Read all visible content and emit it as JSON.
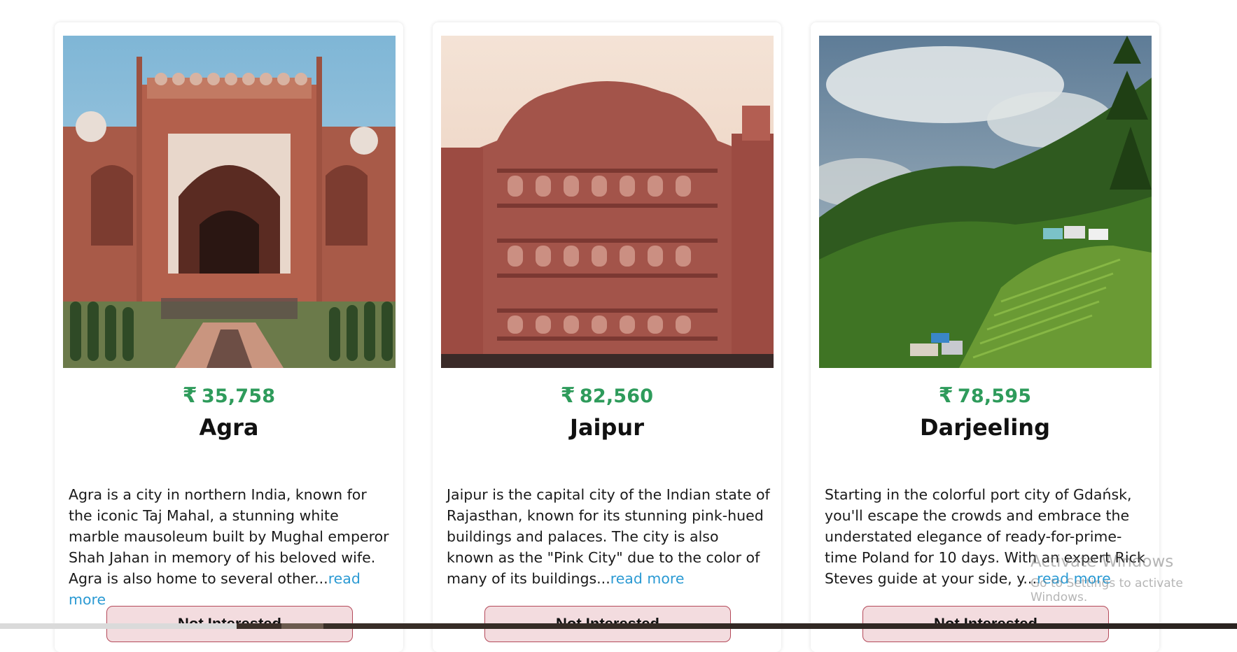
{
  "cards": [
    {
      "price": "35,758",
      "currency_symbol": "₹",
      "title": "Agra",
      "description": "Agra is a city in northern India, known for the iconic Taj Mahal, a stunning white marble mausoleum built by Mughal emperor Shah Jahan in memory of his beloved wife. Agra is also home to several other...",
      "read_more": "read more",
      "button_label": "Not Interested",
      "image_alt": "Agra"
    },
    {
      "price": "82,560",
      "currency_symbol": "₹",
      "title": "Jaipur",
      "description": "Jaipur is the capital city of the Indian state of Rajasthan, known for its stunning pink-hued buildings and palaces. The city is also known as the \"Pink City\" due to the color of many of its buildings...",
      "read_more": "read more",
      "button_label": "Not Interested",
      "image_alt": "Jaipur"
    },
    {
      "price": "78,595",
      "currency_symbol": "₹",
      "title": "Darjeeling",
      "description": "Starting in the colorful port city of Gdańsk, you'll escape the crowds and embrace the understated elegance of ready-for-prime-time Poland for 10 days. With an expert Rick Steves guide at your side, y...",
      "read_more": "read more",
      "button_label": "Not Interested",
      "image_alt": "Darjeeling"
    }
  ],
  "watermark": {
    "title": "Activate Windows",
    "subtitle": "Go to Settings to activate Windows."
  },
  "colors": {
    "price": "#2e9b5b",
    "link": "#2b9ad3",
    "button_bg": "#f3dcdf",
    "button_border": "#b44a5a"
  }
}
